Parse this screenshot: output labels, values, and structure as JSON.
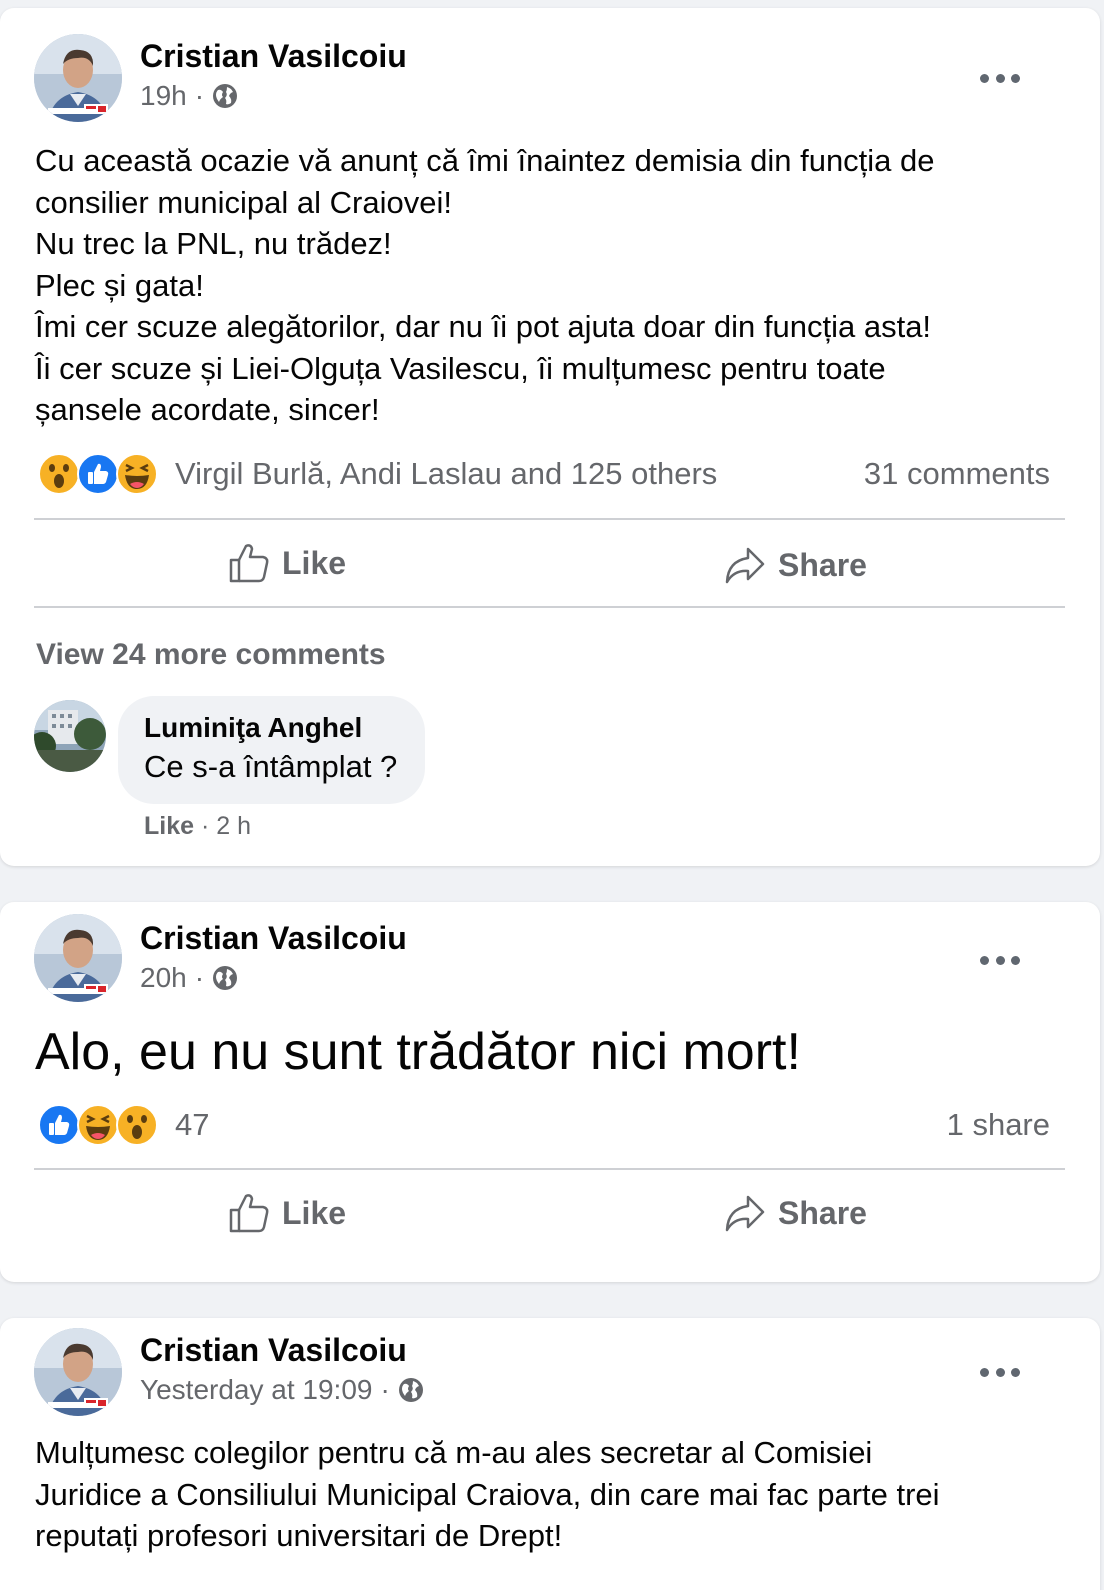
{
  "colors": {
    "background": "#f0f2f5",
    "card": "#ffffff",
    "secondary_text": "#65676b",
    "like_blue": "#1877f2",
    "emoji_yellow": "#f7b125"
  },
  "posts": [
    {
      "author": "Cristian Vasilcoiu",
      "time": "19h",
      "separator": "·",
      "audience_icon": "globe-icon",
      "text_lines": [
        "Cu această ocazie vă anunț că îmi înaintez demisia din funcția de",
        "consilier municipal al Craiovei!",
        "Nu trec la PNL, nu trădez!",
        "Plec și gata!",
        "Îmi cer scuze alegătorilor, dar nu îi pot ajuta doar din funcția asta!",
        "Îi cer scuze și Liei-Olguța Vasilescu, îi mulțumesc pentru toate",
        "șansele acordate, sincer!"
      ],
      "reactions": [
        "wow-icon",
        "like-icon",
        "haha-icon"
      ],
      "reaction_summary": "Virgil Burlă, Andi Laslau and 125 others",
      "right_stat": "31 comments",
      "like_label": "Like",
      "share_label": "Share",
      "view_more_comments": "View 24 more comments",
      "comment": {
        "author": "Luminiţa Anghel",
        "text": "Ce s-a întâmplat ?",
        "like_label": "Like",
        "separator": "·",
        "time": "2 h"
      }
    },
    {
      "author": "Cristian Vasilcoiu",
      "time": "20h",
      "separator": "·",
      "audience_icon": "globe-icon",
      "text": "Alo, eu nu sunt trădător nici mort!",
      "reactions": [
        "like-icon",
        "haha-icon",
        "wow-icon"
      ],
      "reaction_summary": "47",
      "right_stat": "1 share",
      "like_label": "Like",
      "share_label": "Share"
    },
    {
      "author": "Cristian Vasilcoiu",
      "time": "Yesterday at 19:09",
      "separator": "·",
      "audience_icon": "globe-icon",
      "text_lines": [
        "Mulțumesc colegilor pentru că m-au ales secretar al Comisiei",
        "Juridice a Consiliului Municipal Craiova, din care mai fac parte trei",
        "reputați profesori universitari de Drept!"
      ]
    }
  ]
}
